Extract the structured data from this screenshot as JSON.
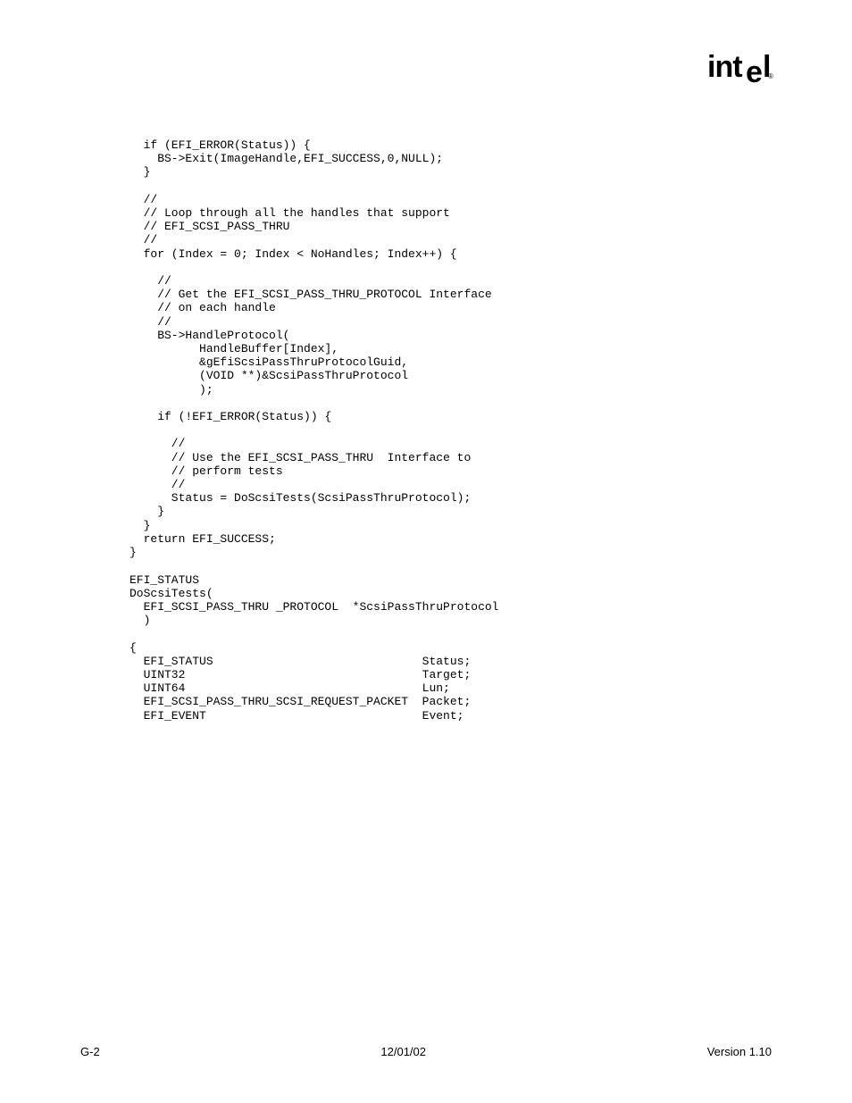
{
  "logo": {
    "text": "intel",
    "registered": "®"
  },
  "code": {
    "lines": [
      "  if (EFI_ERROR(Status)) {",
      "    BS->Exit(ImageHandle,EFI_SUCCESS,0,NULL);",
      "  }",
      "",
      "  //",
      "  // Loop through all the handles that support",
      "  // EFI_SCSI_PASS_THRU",
      "  //",
      "  for (Index = 0; Index < NoHandles; Index++) {",
      "",
      "    //",
      "    // Get the EFI_SCSI_PASS_THRU_PROTOCOL Interface",
      "    // on each handle",
      "    //",
      "    BS->HandleProtocol(",
      "          HandleBuffer[Index],",
      "          &gEfiScsiPassThruProtocolGuid,",
      "          (VOID **)&ScsiPassThruProtocol",
      "          );",
      "",
      "    if (!EFI_ERROR(Status)) {",
      "",
      "      //",
      "      // Use the EFI_SCSI_PASS_THRU  Interface to",
      "      // perform tests",
      "      //",
      "      Status = DoScsiTests(ScsiPassThruProtocol);",
      "    }",
      "  }",
      "  return EFI_SUCCESS;",
      "}",
      "",
      "EFI_STATUS",
      "DoScsiTests(",
      "  EFI_SCSI_PASS_THRU _PROTOCOL  *ScsiPassThruProtocol",
      "  )",
      "",
      "{",
      "  EFI_STATUS                              Status;",
      "  UINT32                                  Target;",
      "  UINT64                                  Lun;",
      "  EFI_SCSI_PASS_THRU_SCSI_REQUEST_PACKET  Packet;",
      "  EFI_EVENT                               Event;"
    ]
  },
  "footer": {
    "left": "G-2",
    "center": "12/01/02",
    "right": "Version 1.10"
  }
}
